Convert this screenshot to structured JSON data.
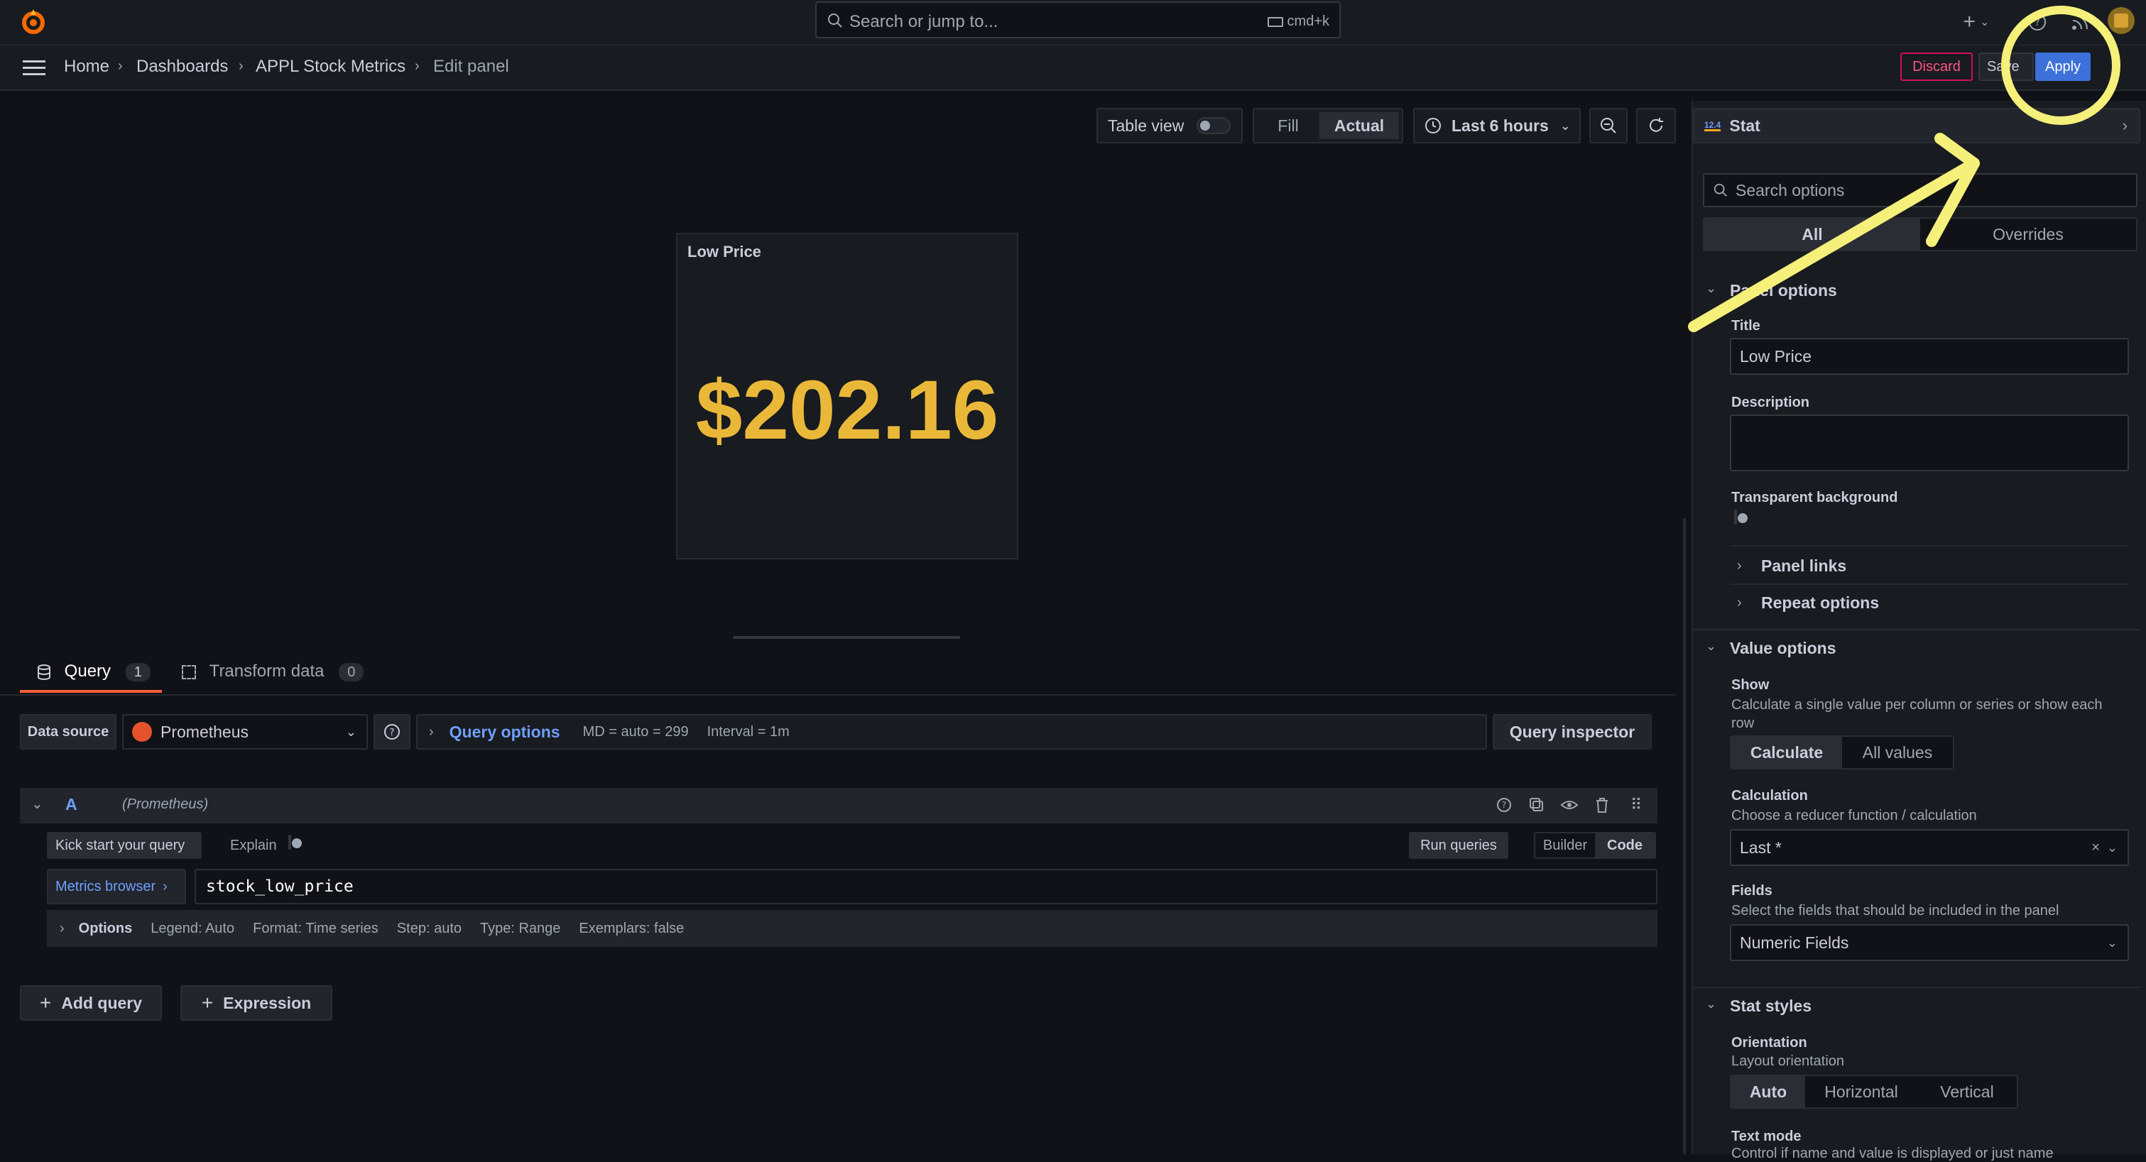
{
  "topbar": {
    "search_placeholder": "Search or jump to...",
    "shortcut": "cmd+k"
  },
  "breadcrumb": [
    "Home",
    "Dashboards",
    "APPL Stock Metrics",
    "Edit panel"
  ],
  "actions": {
    "discard": "Discard",
    "save": "Save",
    "apply": "Apply"
  },
  "toolbar": {
    "table_view": "Table view",
    "fill": "Fill",
    "actual": "Actual",
    "time_range": "Last 6 hours"
  },
  "panel": {
    "title": "Low Price",
    "value": "$202.16",
    "value_color": "#eab839"
  },
  "query_tabs": [
    {
      "label": "Query",
      "count": "1"
    },
    {
      "label": "Transform data",
      "count": "0"
    }
  ],
  "datasource": {
    "label": "Data source",
    "name": "Prometheus",
    "query_options": "Query options",
    "md": "MD = auto = 299",
    "interval": "Interval = 1m",
    "inspector": "Query inspector"
  },
  "query": {
    "ref": "A",
    "source": "(Prometheus)",
    "kick_start": "Kick start your query",
    "explain": "Explain",
    "run": "Run queries",
    "builder": "Builder",
    "code": "Code",
    "metrics_browser": "Metrics browser",
    "expression": "stock_low_price",
    "options_label": "Options",
    "legend": "Legend: Auto",
    "format": "Format: Time series",
    "step": "Step: auto",
    "type": "Type: Range",
    "exemplars": "Exemplars: false"
  },
  "add_query": "Add query",
  "add_expression": "Expression",
  "right_pane": {
    "viz_name": "Stat",
    "viz_badge": "12.4",
    "search_placeholder": "Search options",
    "tab_all": "All",
    "tab_overrides": "Overrides",
    "panel_options": "Panel options",
    "title_label": "Title",
    "title_value": "Low Price",
    "description_label": "Description",
    "transparent_label": "Transparent background",
    "panel_links": "Panel links",
    "repeat_options": "Repeat options",
    "value_options": "Value options",
    "show_label": "Show",
    "show_desc": "Calculate a single value per column or series or show each row",
    "show_calculate": "Calculate",
    "show_all": "All values",
    "calc_label": "Calculation",
    "calc_desc": "Choose a reducer function / calculation",
    "calc_value": "Last *",
    "fields_label": "Fields",
    "fields_desc": "Select the fields that should be included in the panel",
    "fields_value": "Numeric Fields",
    "stat_styles": "Stat styles",
    "orientation_label": "Orientation",
    "orientation_desc": "Layout orientation",
    "orient_auto": "Auto",
    "orient_horizontal": "Horizontal",
    "orient_vertical": "Vertical",
    "text_mode_label": "Text mode",
    "text_mode_desc": "Control if name and value is displayed or just name"
  },
  "annotation_color": "#f5f07a"
}
